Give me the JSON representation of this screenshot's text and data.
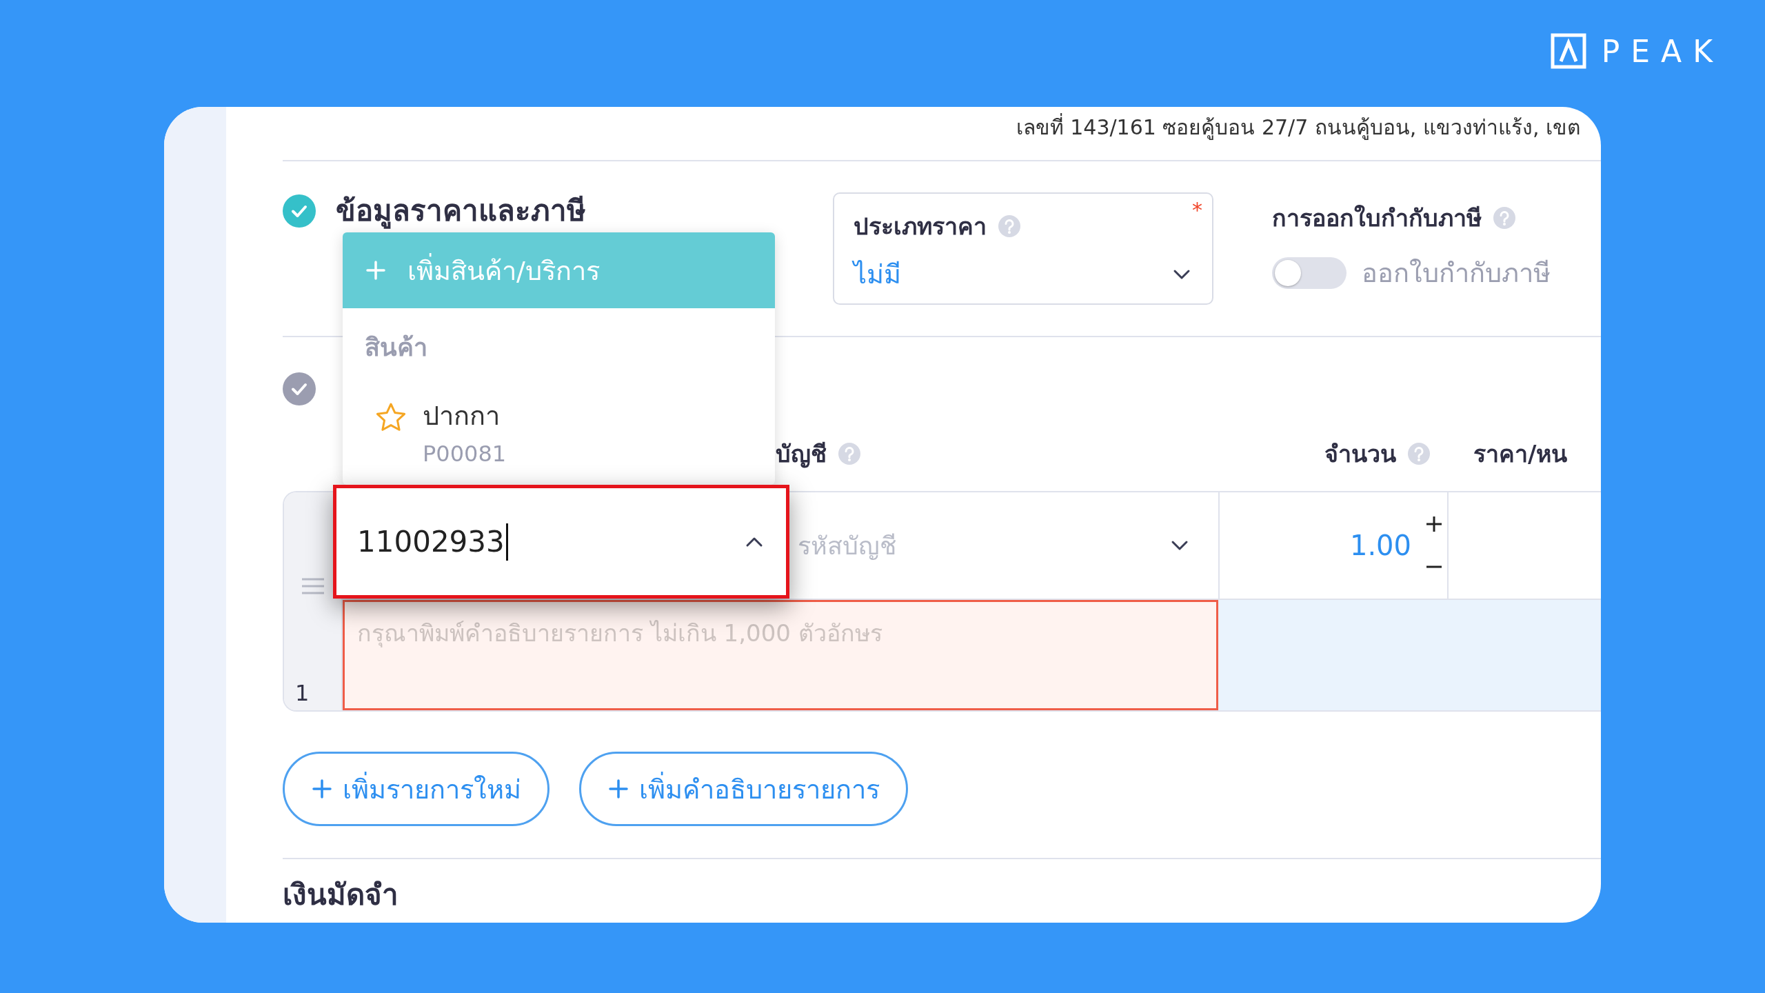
{
  "logo": {
    "text": "PEAK"
  },
  "address_line": "เลขที่ 143/161 ซอยคู้บอน 27/7 ถนนคู้บอน, แขวงท่าแร้ง, เขต",
  "price_section": {
    "title": "ข้อมูลราคาและภาษี",
    "active": true,
    "price_type": {
      "label": "ประเภทราคา",
      "required_mark": "*",
      "value": "ไม่มี"
    },
    "tax_invoice": {
      "label": "การออกใบกำกับภาษี",
      "on": false,
      "toggle_label": "ออกใบกำกับภาษี"
    }
  },
  "items_section": {
    "active": false,
    "columns": [
      {
        "label": "บัญชี",
        "help": true
      },
      {
        "label": "จำนวน",
        "help": true
      },
      {
        "label": "ราคา/หน",
        "help": false
      }
    ],
    "rows": [
      {
        "number": "1",
        "account_placeholder": "รหัสบัญชี",
        "quantity": "1.00",
        "description_placeholder": "กรุณาพิมพ์คำอธิบายรายการ ไม่เกิน 1,000 ตัวอักษร",
        "description_error": true
      }
    ]
  },
  "product_dropdown": {
    "add_label": "เพิ่มสินค้า/บริการ",
    "group": "สินค้า",
    "items": [
      {
        "name": "ปากกา",
        "code": "P00081"
      }
    ]
  },
  "search_field": {
    "value": "11002933",
    "error": true,
    "expanded": true
  },
  "buttons": [
    {
      "label": "เพิ่มรายการใหม่"
    },
    {
      "label": "เพิ่มคำอธิบายรายการ"
    }
  ],
  "deposit_title": "เงินมัดจำ"
}
